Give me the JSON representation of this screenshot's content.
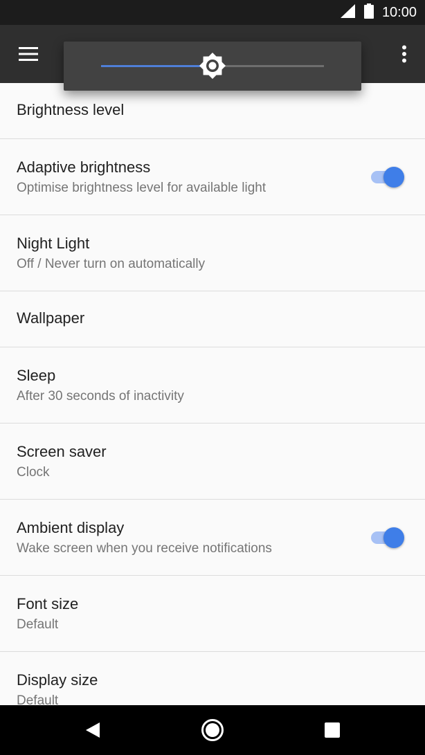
{
  "status_bar": {
    "time": "10:00",
    "icons": [
      "cell-signal-icon",
      "battery-icon"
    ]
  },
  "app_bar": {
    "menu_icon": "hamburger-menu-icon",
    "more_icon": "more-vert-icon"
  },
  "brightness_slider": {
    "level": 0.5,
    "thumb_icon": "brightness-sun-icon"
  },
  "settings": [
    {
      "title": "Brightness level"
    },
    {
      "title": "Adaptive brightness",
      "subtitle": "Optimise brightness level for available light",
      "toggle": true
    },
    {
      "title": "Night Light",
      "subtitle": "Off / Never turn on automatically"
    },
    {
      "title": "Wallpaper"
    },
    {
      "title": "Sleep",
      "subtitle": "After 30 seconds of inactivity"
    },
    {
      "title": "Screen saver",
      "subtitle": "Clock"
    },
    {
      "title": "Ambient display",
      "subtitle": "Wake screen when you receive notifications",
      "toggle": true
    },
    {
      "title": "Font size",
      "subtitle": "Default"
    },
    {
      "title": "Display size",
      "subtitle": "Default"
    }
  ],
  "nav_bar": {
    "back_icon": "back-triangle-icon",
    "home_icon": "home-circle-icon",
    "recents_icon": "recents-square-icon"
  },
  "colors": {
    "accent": "#3f7ee8",
    "app_bar": "#2f2f2f",
    "status_bar": "#1c1c1c"
  }
}
